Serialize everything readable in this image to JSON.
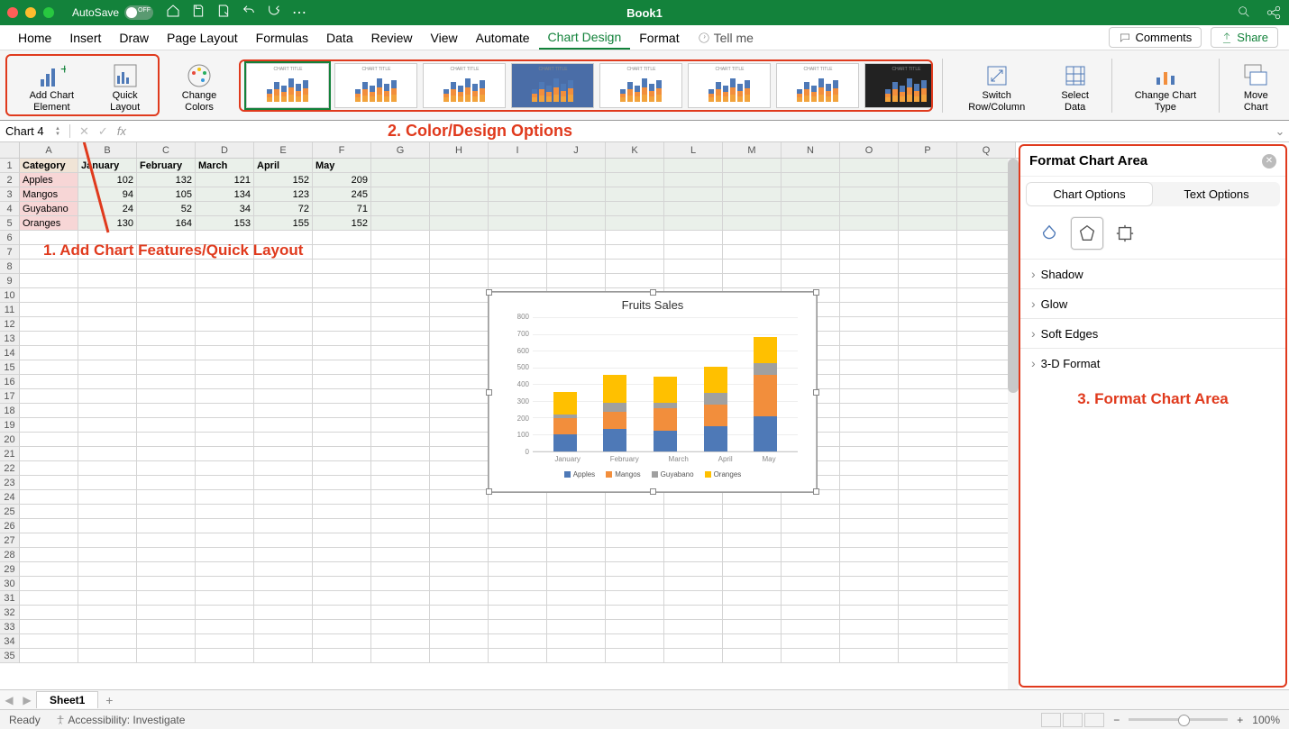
{
  "app": {
    "title": "Book1",
    "autosave_label": "AutoSave",
    "autosave_state": "OFF"
  },
  "menu": {
    "tabs": [
      "Home",
      "Insert",
      "Draw",
      "Page Layout",
      "Formulas",
      "Data",
      "Review",
      "View",
      "Automate",
      "Chart Design",
      "Format"
    ],
    "active": "Chart Design",
    "tell_me": "Tell me",
    "comments": "Comments",
    "share": "Share"
  },
  "ribbon": {
    "add_element": "Add Chart Element",
    "quick_layout": "Quick Layout",
    "change_colors": "Change Colors",
    "switch_rowcol": "Switch Row/Column",
    "select_data": "Select Data",
    "change_type": "Change Chart Type",
    "move_chart": "Move Chart"
  },
  "annotations": {
    "one": "1. Add Chart Features/Quick Layout",
    "two": "2. Color/Design Options",
    "three": "3. Format Chart Area"
  },
  "name_box": "Chart 4",
  "sheet": {
    "columns": [
      "A",
      "B",
      "C",
      "D",
      "E",
      "F",
      "G",
      "H",
      "I",
      "J",
      "K",
      "L",
      "M",
      "N",
      "O",
      "P",
      "Q"
    ],
    "headers": [
      "Category",
      "January",
      "February",
      "March",
      "April",
      "May"
    ],
    "rows": [
      {
        "cat": "Apples",
        "vals": [
          102,
          132,
          121,
          152,
          209
        ]
      },
      {
        "cat": "Mangos",
        "vals": [
          94,
          105,
          134,
          123,
          245
        ]
      },
      {
        "cat": "Guyabano",
        "vals": [
          24,
          52,
          34,
          72,
          71
        ]
      },
      {
        "cat": "Oranges",
        "vals": [
          130,
          164,
          153,
          155,
          152
        ]
      }
    ],
    "row_count": 35
  },
  "chart_data": {
    "type": "bar",
    "stacked": true,
    "title": "Fruits Sales",
    "categories": [
      "January",
      "February",
      "March",
      "April",
      "May"
    ],
    "series": [
      {
        "name": "Apples",
        "values": [
          102,
          132,
          121,
          152,
          209
        ],
        "color": "#4e79b7"
      },
      {
        "name": "Mangos",
        "values": [
          94,
          105,
          134,
          123,
          245
        ],
        "color": "#f28e3c"
      },
      {
        "name": "Guyabano",
        "values": [
          24,
          52,
          34,
          72,
          71
        ],
        "color": "#a0a0a0"
      },
      {
        "name": "Oranges",
        "values": [
          130,
          164,
          153,
          155,
          152
        ],
        "color": "#ffc000"
      }
    ],
    "ylim": [
      0,
      800
    ],
    "ytick": 100,
    "xlabel": "",
    "ylabel": ""
  },
  "format_pane": {
    "title": "Format Chart Area",
    "tab_chart": "Chart Options",
    "tab_text": "Text Options",
    "sections": [
      "Shadow",
      "Glow",
      "Soft Edges",
      "3-D Format"
    ]
  },
  "sheet_tabs": {
    "active": "Sheet1"
  },
  "status": {
    "ready": "Ready",
    "accessibility": "Accessibility: Investigate",
    "zoom": "100%"
  }
}
